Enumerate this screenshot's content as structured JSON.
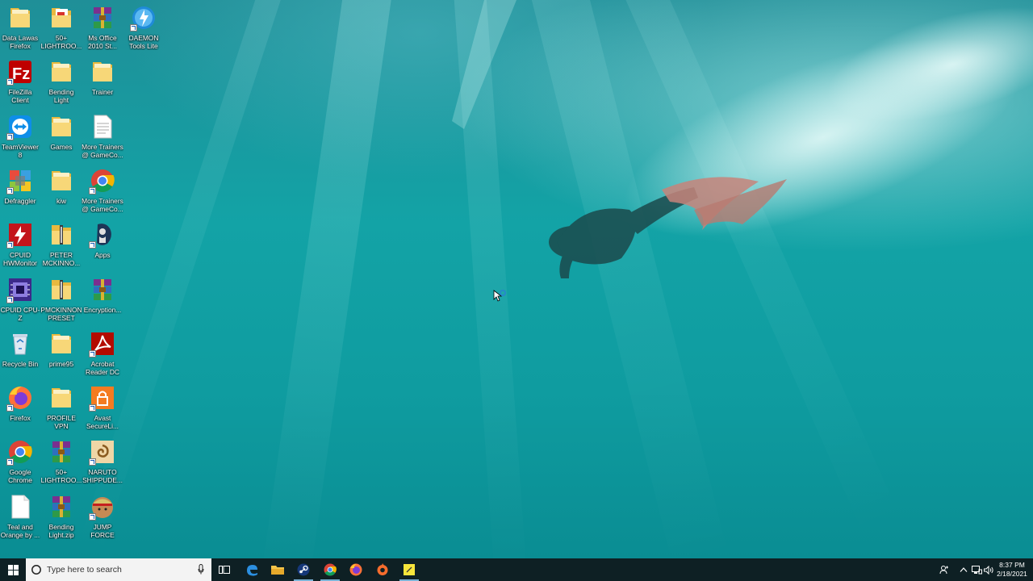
{
  "desktop": {
    "icons": [
      {
        "label": "Data Lawas\nFirefox",
        "icon": "folder-icon"
      },
      {
        "label": "50+\nLIGHTROO...",
        "icon": "pdf-folder-icon"
      },
      {
        "label": "Ms Office\n2010 St...",
        "icon": "winrar-archive-icon"
      },
      {
        "label": "DAEMON\nTools Lite",
        "icon": "daemon-tools-icon"
      },
      {
        "label": "FileZilla\nClient",
        "icon": "filezilla-icon"
      },
      {
        "label": "Bending\nLight",
        "icon": "folder-icon"
      },
      {
        "label": "Trainer",
        "icon": "folder-icon"
      },
      {
        "label": "TeamViewer\n8",
        "icon": "teamviewer-icon"
      },
      {
        "label": "Games",
        "icon": "folder-icon"
      },
      {
        "label": "More Trainers\n@ GameCo...",
        "icon": "text-document-icon"
      },
      {
        "label": "Defraggler",
        "icon": "defraggler-icon"
      },
      {
        "label": "kiw",
        "icon": "folder-icon"
      },
      {
        "label": "More Trainers\n@ GameCo...",
        "icon": "chrome-icon"
      },
      {
        "label": "CPUID\nHWMonitor",
        "icon": "hwmonitor-icon"
      },
      {
        "label": "PETER\nMCKINNO...",
        "icon": "zip-folder-icon"
      },
      {
        "label": "Apps",
        "icon": "apps-icon"
      },
      {
        "label": "CPUID CPU-Z",
        "icon": "cpuz-icon"
      },
      {
        "label": "PMCKINNON\nPRESET PA...",
        "icon": "zip-folder-icon"
      },
      {
        "label": "Encryption...",
        "icon": "winrar-archive-icon"
      },
      {
        "label": "Recycle Bin",
        "icon": "recycle-bin-icon"
      },
      {
        "label": "prime95",
        "icon": "folder-icon"
      },
      {
        "label": "Acrobat\nReader DC",
        "icon": "acrobat-icon"
      },
      {
        "label": "Firefox",
        "icon": "firefox-icon"
      },
      {
        "label": "PROFILE VPN\nBARU COY",
        "icon": "folder-icon"
      },
      {
        "label": "Avast\nSecureLi...",
        "icon": "avast-secureline-icon"
      },
      {
        "label": "Google\nChrome",
        "icon": "chrome-icon"
      },
      {
        "label": "50+\nLIGHTROO...",
        "icon": "winrar-archive-icon"
      },
      {
        "label": "NARUTO\nSHIPPUDE...",
        "icon": "naruto-game-icon"
      },
      {
        "label": "Teal and\nOrange by ...",
        "icon": "blank-document-icon"
      },
      {
        "label": "Bending\nLight.zip",
        "icon": "winrar-archive-icon"
      },
      {
        "label": "JUMP FORCE",
        "icon": "jump-force-icon"
      }
    ]
  },
  "taskbar": {
    "search_placeholder": "Type here to search",
    "pinned": [
      "task-view-icon",
      "edge-icon",
      "file-explorer-icon",
      "steam-icon",
      "chrome-icon",
      "firefox-icon",
      "origin-icon",
      "sticky-notes-icon"
    ],
    "clock_time": "8:37 PM",
    "clock_date": "2/18/2021",
    "tray_icons": [
      "people-icon",
      "chevron-up-icon",
      "network-icon",
      "volume-icon"
    ]
  },
  "colors": {
    "taskbar_bg": "#0e2024",
    "wallpaper_teal": "#13a3a6",
    "folder_yellow": "#f5d56b"
  }
}
